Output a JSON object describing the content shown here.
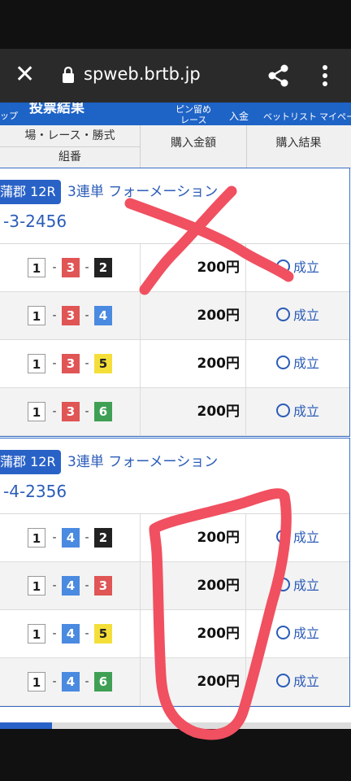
{
  "browser": {
    "url": "spweb.brtb.jp"
  },
  "nav": {
    "items": [
      "ップ",
      "投票結果",
      "ピン留め",
      "レース",
      "入金",
      "ベットリスト",
      "マイペー"
    ]
  },
  "table_header": {
    "col1_top": "場・レース・勝式",
    "col1_bottom": "組番",
    "col2": "購入金額",
    "col3": "購入結果"
  },
  "blocks": [
    {
      "venue": "蒲郡 12R",
      "bet_type": "3連単 フォーメーション",
      "combo": "-3-2456",
      "rows": [
        {
          "n1": "1",
          "n2": "3",
          "n3": "2",
          "amount": "200円",
          "result": "成立"
        },
        {
          "n1": "1",
          "n2": "3",
          "n3": "4",
          "amount": "200円",
          "result": "成立"
        },
        {
          "n1": "1",
          "n2": "3",
          "n3": "5",
          "amount": "200円",
          "result": "成立"
        },
        {
          "n1": "1",
          "n2": "3",
          "n3": "6",
          "amount": "200円",
          "result": "成立"
        }
      ]
    },
    {
      "venue": "蒲郡 12R",
      "bet_type": "3連単 フォーメーション",
      "combo": "-4-2356",
      "rows": [
        {
          "n1": "1",
          "n2": "4",
          "n3": "2",
          "amount": "200円",
          "result": "成立"
        },
        {
          "n1": "1",
          "n2": "4",
          "n3": "3",
          "amount": "200円",
          "result": "成立"
        },
        {
          "n1": "1",
          "n2": "4",
          "n3": "5",
          "amount": "200円",
          "result": "成立"
        },
        {
          "n1": "1",
          "n2": "4",
          "n3": "6",
          "amount": "200円",
          "result": "成立"
        }
      ]
    }
  ],
  "colors": {
    "accent": "#2962c7",
    "boat1": "#ffffff",
    "boat2": "#222222",
    "boat3": "#e05555",
    "boat4": "#4a8ae0",
    "boat5": "#f4df3a",
    "boat6": "#3fa055",
    "annotation": "#f05060"
  },
  "icons": [
    "close-icon",
    "lock-icon",
    "share-icon",
    "more-vert-icon",
    "result-circle-icon"
  ]
}
